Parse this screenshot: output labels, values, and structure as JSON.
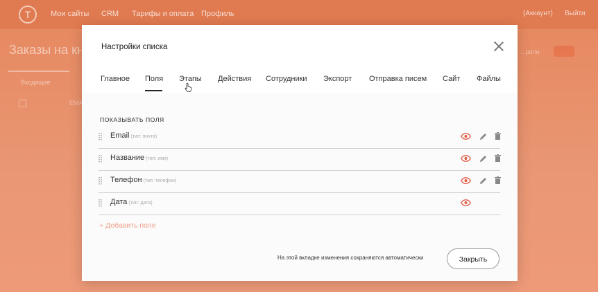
{
  "topbar": {
    "logo_letter": "T",
    "nav": [
      "Мои сайты",
      "CRM",
      "Тарифы и оплата",
      "Профиль"
    ],
    "account_label": "(Аккаунт)",
    "logout_label": "Выйти"
  },
  "background": {
    "page_title": "Заказы на кн",
    "sub_tab": "Входящие",
    "row_snippet": "EMA",
    "right_label": "...роли"
  },
  "modal": {
    "title": "Настройки списка",
    "tabs": [
      "Главное",
      "Поля",
      "Этапы",
      "Действия",
      "Сотрудники",
      "Экспорт",
      "Отправка писем",
      "Сайт",
      "Файлы"
    ],
    "active_tab": "Поля",
    "section_label": "ПОКАЗЫВАТЬ ПОЛЯ",
    "fields": [
      {
        "name": "Email",
        "type": "(тип: почта)",
        "editable": true
      },
      {
        "name": "Название",
        "type": "(тип: имя)",
        "editable": true
      },
      {
        "name": "Телефон",
        "type": "(тип: телефон)",
        "editable": true
      },
      {
        "name": "Дата",
        "type": "(тип: дата)",
        "editable": false
      }
    ],
    "add_field": "+ Добавить поле",
    "autosave_note": "На этой вкладке изменения сохраняются автоматически",
    "close_button": "Закрыть"
  },
  "colors": {
    "accent": "#e07a50",
    "eye_icon": "#e05a45",
    "add_link": "#f0a089"
  },
  "icons": [
    "close-icon",
    "drag-handle-icon",
    "eye-icon",
    "pencil-icon",
    "trash-icon",
    "cursor-hand-icon"
  ]
}
